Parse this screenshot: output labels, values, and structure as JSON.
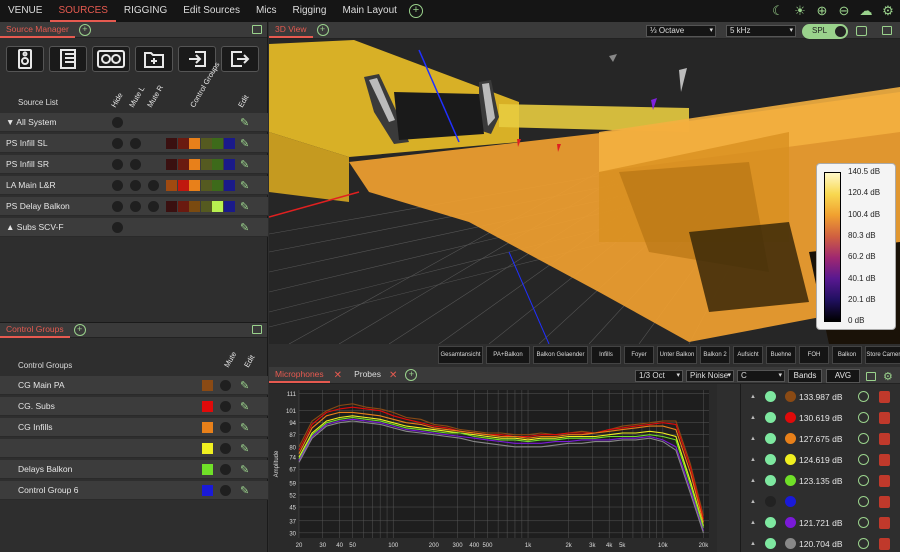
{
  "menu": {
    "items": [
      "VENUE",
      "SOURCES",
      "RIGGING",
      "Edit Sources",
      "Mics",
      "Rigging",
      "Main Layout"
    ],
    "active": "SOURCES"
  },
  "source_manager": {
    "title": "Source Manager",
    "headers": {
      "list": "Source List",
      "hide": "Hide",
      "mute_l": "Mute L",
      "mute_r": "Mute R",
      "control_groups": "Control Groups",
      "edit": "Edit"
    },
    "rows": [
      {
        "label": "▼  All System",
        "dots": 1,
        "swatches": []
      },
      {
        "label": "PS  Infill SL",
        "dots": 2,
        "swatches": [
          "#3a1010",
          "#6a1a10",
          "#e8801a",
          "#555a20",
          "#3d6a1a",
          "#1a1a8a"
        ]
      },
      {
        "label": "PS  Infill SR",
        "dots": 2,
        "swatches": [
          "#3a1010",
          "#6a1a10",
          "#e8801a",
          "#555a20",
          "#3d6a1a",
          "#1a1a8a"
        ]
      },
      {
        "label": "LA  Main L&R",
        "dots": 3,
        "swatches": [
          "#a04a10",
          "#c0180e",
          "#e8801a",
          "#555a20",
          "#3d6a1a",
          "#1a1a8a"
        ]
      },
      {
        "label": "PS  Delay Balkon",
        "dots": 3,
        "swatches": [
          "#3a1010",
          "#6a1a10",
          "#7a4a10",
          "#555a20",
          "#b8f050",
          "#1a1a8a"
        ]
      },
      {
        "label": "▲  Subs SCV-F",
        "dots": 1,
        "swatches": []
      }
    ]
  },
  "control_groups": {
    "title": "Control Groups",
    "header": "Control Groups",
    "mute": "Mute",
    "edit": "Edit",
    "rows": [
      {
        "label": "CG Main PA",
        "color": "#8a4a14"
      },
      {
        "label": "CG. Subs",
        "color": "#e00a0a"
      },
      {
        "label": "CG Infills",
        "color": "#e8801a"
      },
      {
        "label": "",
        "color": "#f0f020"
      },
      {
        "label": "Delays Balkon",
        "color": "#70e028"
      },
      {
        "label": "Control Group 6",
        "color": "#1a1ad8"
      }
    ]
  },
  "view3d": {
    "title": "3D View",
    "octave": "⅓ Octave",
    "freq": "5 kHz",
    "spl": "SPL",
    "scale": [
      "140.5 dB",
      "120.4 dB",
      "100.4 dB",
      "80.3 dB",
      "60.2 dB",
      "40.1 dB",
      "20.1 dB",
      "0 dB"
    ],
    "presets": [
      "Gesamtansicht",
      "PA+Balkon",
      "Balkon Gelaender",
      "Infills",
      "Foyer",
      "Unter Balkon",
      "Balkon 2",
      "Aufsicht",
      "Buehne",
      "FOH",
      "Balkon",
      "Store Camera"
    ]
  },
  "bottom": {
    "tab_mics": "Microphones",
    "tab_probes": "Probes",
    "res": "1/3 Oct",
    "noise": "Pink Noise",
    "weight": "C",
    "bands": "Bands",
    "avg": "AVG"
  },
  "mics": [
    {
      "color": "#8a4a14",
      "value": "133.987 dB"
    },
    {
      "color": "#e00a0a",
      "value": "130.619 dB"
    },
    {
      "color": "#e8801a",
      "value": "127.675 dB"
    },
    {
      "color": "#f0f020",
      "value": "124.619 dB"
    },
    {
      "color": "#70e028",
      "value": "123.135 dB"
    },
    {
      "color": "#1a1ad8",
      "value": ""
    },
    {
      "color": "#7a1ad8",
      "value": "121.721 dB"
    },
    {
      "color": "#888888",
      "value": "120.704 dB"
    }
  ],
  "chart_data": {
    "type": "line",
    "ylabel": "Amplitude",
    "yticks": [
      111,
      101,
      94,
      87,
      80,
      74,
      67,
      59,
      52,
      45,
      37,
      30
    ],
    "ylim": [
      27,
      113
    ],
    "xticks": [
      "20",
      "30",
      "40",
      "50",
      "100",
      "200",
      "300",
      "400",
      "500",
      "1k",
      "2k",
      "3k",
      "4k",
      "5k",
      "10k",
      "20k"
    ],
    "xvals": [
      20,
      30,
      40,
      50,
      100,
      200,
      300,
      400,
      500,
      1000,
      2000,
      3000,
      4000,
      5000,
      10000,
      20000
    ],
    "xlim": [
      20,
      22000
    ],
    "log_x": true,
    "series": [
      {
        "color": "#8a4a14",
        "x": [
          20,
          25,
          32,
          40,
          50,
          63,
          80,
          100,
          125,
          160,
          200,
          250,
          315,
          400,
          500,
          630,
          800,
          1000,
          1250,
          1600,
          2000,
          2500,
          3150,
          4000,
          5000,
          6300,
          8000,
          10000,
          12500,
          16000,
          20000
        ],
        "y": [
          80,
          95,
          101,
          104,
          105,
          103,
          102,
          100,
          97,
          96,
          93,
          92,
          90,
          89,
          88,
          88,
          87,
          87,
          88,
          87,
          88,
          89,
          88,
          90,
          92,
          93,
          94,
          95,
          95,
          70,
          40
        ]
      },
      {
        "color": "#e00a0a",
        "x": [
          20,
          25,
          32,
          40,
          50,
          63,
          80,
          100,
          125,
          160,
          200,
          250,
          315,
          400,
          500,
          630,
          800,
          1000,
          1250,
          1600,
          2000,
          2500,
          3150,
          4000,
          5000,
          6300,
          8000,
          10000,
          12500,
          16000,
          20000
        ],
        "y": [
          78,
          93,
          100,
          102,
          103,
          102,
          101,
          98,
          96,
          94,
          92,
          91,
          89,
          88,
          87,
          87,
          86,
          86,
          87,
          87,
          88,
          88,
          88,
          90,
          91,
          92,
          93,
          94,
          93,
          68,
          38
        ]
      },
      {
        "color": "#e8801a",
        "x": [
          20,
          25,
          32,
          40,
          50,
          63,
          80,
          100,
          125,
          160,
          200,
          250,
          315,
          400,
          500,
          630,
          800,
          1000,
          1250,
          1600,
          2000,
          2500,
          3150,
          4000,
          5000,
          6300,
          8000,
          10000,
          12500,
          16000,
          20000
        ],
        "y": [
          76,
          91,
          98,
          100,
          100,
          99,
          98,
          96,
          94,
          93,
          91,
          90,
          89,
          88,
          87,
          86,
          86,
          85,
          86,
          86,
          87,
          87,
          88,
          89,
          90,
          91,
          92,
          92,
          90,
          65,
          36
        ]
      },
      {
        "color": "#f0f020",
        "x": [
          20,
          25,
          32,
          40,
          50,
          63,
          80,
          100,
          125,
          160,
          200,
          250,
          315,
          400,
          500,
          630,
          800,
          1000,
          1250,
          1600,
          2000,
          2500,
          3150,
          4000,
          5000,
          6300,
          8000,
          10000,
          12500,
          16000,
          20000
        ],
        "y": [
          74,
          88,
          95,
          97,
          98,
          97,
          96,
          94,
          92,
          91,
          90,
          89,
          88,
          87,
          86,
          85,
          85,
          84,
          85,
          85,
          86,
          86,
          86,
          87,
          88,
          88,
          89,
          88,
          86,
          60,
          34
        ]
      },
      {
        "color": "#70e028",
        "x": [
          20,
          25,
          32,
          40,
          50,
          63,
          80,
          100,
          125,
          160,
          200,
          250,
          315,
          400,
          500,
          630,
          800,
          1000,
          1250,
          1600,
          2000,
          2500,
          3150,
          4000,
          5000,
          6300,
          8000,
          10000,
          12500,
          16000,
          20000
        ],
        "y": [
          73,
          87,
          94,
          96,
          97,
          96,
          95,
          93,
          91,
          90,
          89,
          88,
          88,
          86,
          85,
          84,
          84,
          83,
          84,
          84,
          85,
          85,
          85,
          86,
          86,
          86,
          87,
          86,
          84,
          58,
          33
        ]
      },
      {
        "color": "#7a1ad8",
        "x": [
          20,
          25,
          32,
          40,
          50,
          63,
          80,
          100,
          125,
          160,
          200,
          250,
          315,
          400,
          500,
          630,
          800,
          1000,
          1250,
          1600,
          2000,
          2500,
          3150,
          4000,
          5000,
          6300,
          8000,
          10000,
          12500,
          16000,
          20000
        ],
        "y": [
          72,
          86,
          93,
          95,
          96,
          95,
          94,
          92,
          90,
          89,
          88,
          87,
          86,
          85,
          84,
          83,
          82,
          82,
          82,
          83,
          83,
          84,
          84,
          84,
          85,
          85,
          86,
          84,
          80,
          55,
          31
        ]
      },
      {
        "color": "#888888",
        "x": [
          20,
          25,
          32,
          40,
          50,
          63,
          80,
          100,
          125,
          160,
          200,
          250,
          315,
          400,
          500,
          630,
          800,
          1000,
          1250,
          1600,
          2000,
          2500,
          3150,
          4000,
          5000,
          6300,
          8000,
          10000,
          12500,
          16000,
          20000
        ],
        "y": [
          71,
          85,
          92,
          94,
          95,
          94,
          93,
          91,
          89,
          88,
          87,
          86,
          85,
          83,
          82,
          81,
          80,
          80,
          80,
          81,
          82,
          82,
          83,
          83,
          84,
          84,
          85,
          83,
          78,
          53,
          30
        ]
      }
    ]
  }
}
